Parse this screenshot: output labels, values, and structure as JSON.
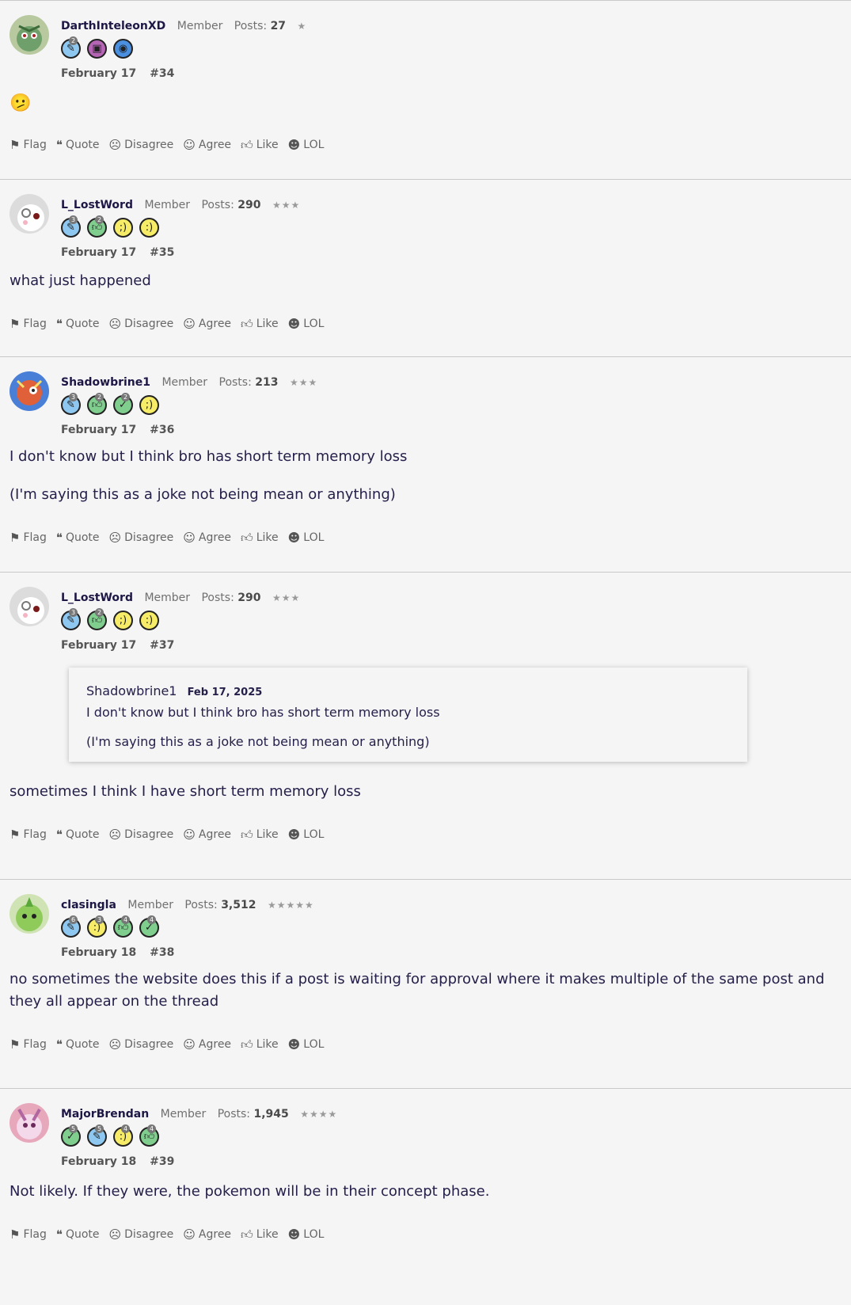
{
  "actions": {
    "flag": "Flag",
    "quote": "Quote",
    "disagree": "Disagree",
    "agree": "Agree",
    "like": "Like",
    "lol": "LOL"
  },
  "posts": [
    {
      "author": "DarthInteleonXD",
      "role": "Member",
      "posts_label": "Posts:",
      "posts": "27",
      "stars": "★",
      "date": "February 17",
      "number": "#34",
      "body": [
        "🫤"
      ]
    },
    {
      "author": "L_LostWord",
      "role": "Member",
      "posts_label": "Posts:",
      "posts": "290",
      "stars": "★★★",
      "date": "February 17",
      "number": "#35",
      "body": [
        "what just happened"
      ]
    },
    {
      "author": "Shadowbrine1",
      "role": "Member",
      "posts_label": "Posts:",
      "posts": "213",
      "stars": "★★★",
      "date": "February 17",
      "number": "#36",
      "body": [
        "I don't know but I think bro has short term memory loss",
        "(I'm saying this as a joke not being mean or anything)"
      ]
    },
    {
      "author": "L_LostWord",
      "role": "Member",
      "posts_label": "Posts:",
      "posts": "290",
      "stars": "★★★",
      "date": "February 17",
      "number": "#37",
      "quote": {
        "author": "Shadowbrine1",
        "date": "Feb 17, 2025",
        "lines": [
          "I don't know but I think bro has short term memory loss",
          "(I'm saying this as a joke not being mean or anything)"
        ]
      },
      "body": [
        "sometimes I think I have short term memory loss"
      ]
    },
    {
      "author": "clasingla",
      "role": "Member",
      "posts_label": "Posts:",
      "posts": "3,512",
      "stars": "★★★★★",
      "date": "February 18",
      "number": "#38",
      "body": [
        "no sometimes the website does this if a post is waiting for approval where it makes multiple of the same post and they all appear on the thread"
      ]
    },
    {
      "author": "MajorBrendan",
      "role": "Member",
      "posts_label": "Posts:",
      "posts": "1,945",
      "stars": "★★★★",
      "date": "February 18",
      "number": "#39",
      "body": [
        "Not likely. If they were, the pokemon will be in their concept phase."
      ]
    }
  ]
}
